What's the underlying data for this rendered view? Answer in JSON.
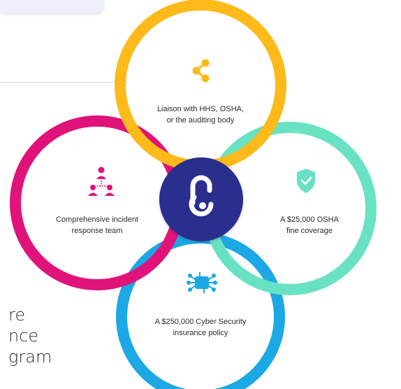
{
  "nodes": {
    "top": {
      "line1": "Liaison with HHS, OSHA,",
      "line2": "or the auditing body",
      "color": "#FDBA1A",
      "icon": "share-icon"
    },
    "left": {
      "line1": "Comprehensive incident",
      "line2": "response team",
      "color": "#E0137A",
      "icon": "team-hierarchy-icon"
    },
    "right": {
      "line1": "A $25,000 OSHA",
      "line2": "fine coverage",
      "color": "#69E2C3",
      "icon": "shield-check-icon"
    },
    "bottom": {
      "line1": "A $250,000 Cyber Security",
      "line2": "insurance policy",
      "color": "#1CA8E5",
      "icon": "cyber-chip-icon"
    }
  },
  "center": {
    "color": "#2B2E8C",
    "icon": "padlock-logo-icon"
  },
  "background_text": {
    "line1": "re",
    "line2": "nce",
    "line3": "gram"
  },
  "colors": {
    "card": "#eef1fb",
    "text": "#2b2b2b"
  }
}
